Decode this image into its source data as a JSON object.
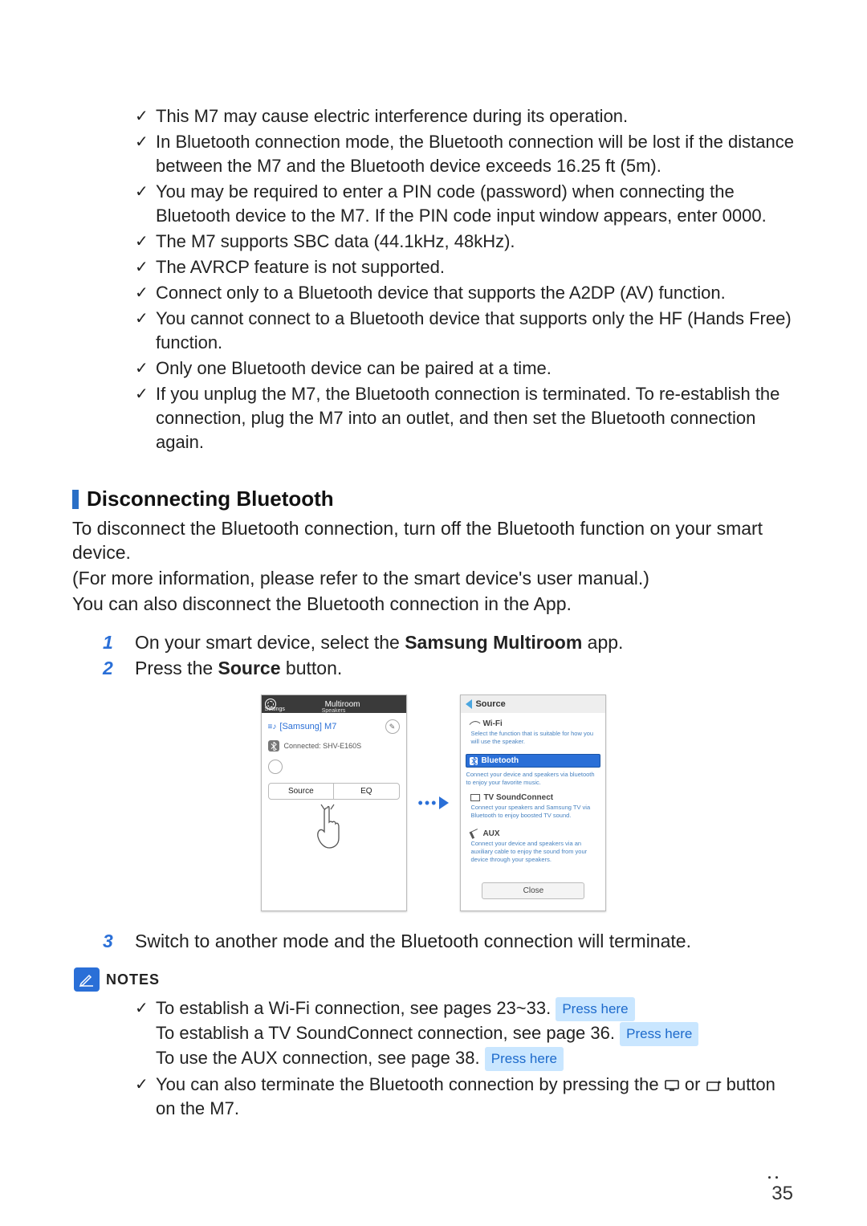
{
  "top_checks": [
    "This M7 may cause electric interference during its operation.",
    "In Bluetooth connection mode, the Bluetooth connection will be lost if the distance between the M7 and the Bluetooth device exceeds 16.25 ft (5m).",
    "You may be required to enter a PIN code (password) when connecting the Bluetooth device to the M7. If the PIN code input window appears, enter 0000.",
    "The M7 supports SBC data (44.1kHz, 48kHz).",
    "The AVRCP feature is not supported.",
    "Connect only to a Bluetooth device that supports the A2DP (AV) function.",
    "You cannot connect to a Bluetooth device that supports only the HF (Hands Free) function.",
    "Only one Bluetooth device can be paired at a time.",
    "If you unplug the M7, the Bluetooth connection is terminated. To re-establish the connection, plug the M7 into an outlet, and then set the Bluetooth connection again."
  ],
  "section": {
    "heading": "Disconnecting Bluetooth",
    "para": [
      "To disconnect the Bluetooth connection, turn off the Bluetooth function on your smart device.",
      "(For more information, please refer to the smart device's user manual.)",
      "You can also disconnect the Bluetooth connection in the App."
    ]
  },
  "steps": {
    "s1_pre": "On your smart device, select the ",
    "s1_bold": "Samsung Multiroom",
    "s1_post": " app.",
    "s2_pre": "Press the ",
    "s2_bold": "Source",
    "s2_post": " button.",
    "s3": "Switch to another mode and the Bluetooth connection will terminate."
  },
  "screen_left": {
    "settings": "Settings",
    "title": "Multiroom",
    "subtitle": "Speakers",
    "speaker": "[Samsung] M7",
    "connected": "Connected: SHV-E160S",
    "seg_source": "Source",
    "seg_eq": "EQ"
  },
  "screen_right": {
    "header": "Source",
    "wifi_title": "Wi-Fi",
    "wifi_desc": "Select the function that is suitable for how you will use the speaker.",
    "bt_title": "Bluetooth",
    "bt_desc": "Connect your device and speakers via bluetooth to enjoy your favorite music.",
    "tvsc_title": "TV SoundConnect",
    "tvsc_desc": "Connect your speakers and Samsung TV via Bluetooth to enjoy boosted TV sound.",
    "aux_title": "AUX",
    "aux_desc": "Connect your device and speakers via an auxiliary cable to enjoy the sound from your device through your speakers.",
    "close": "Close"
  },
  "notes": {
    "label": "NOTES",
    "n1_l1_a": "To establish a Wi-Fi connection, see pages 23~33. ",
    "n1_l2_a": "To establish a TV SoundConnect connection, see page 36. ",
    "n1_l3_a": "To use the AUX connection, see page 38. ",
    "press_here": "Press here",
    "n2_a": "You can also terminate the Bluetooth connection by pressing the ",
    "n2_b": " or ",
    "n2_c": " button on the M7."
  },
  "page_number": "35"
}
